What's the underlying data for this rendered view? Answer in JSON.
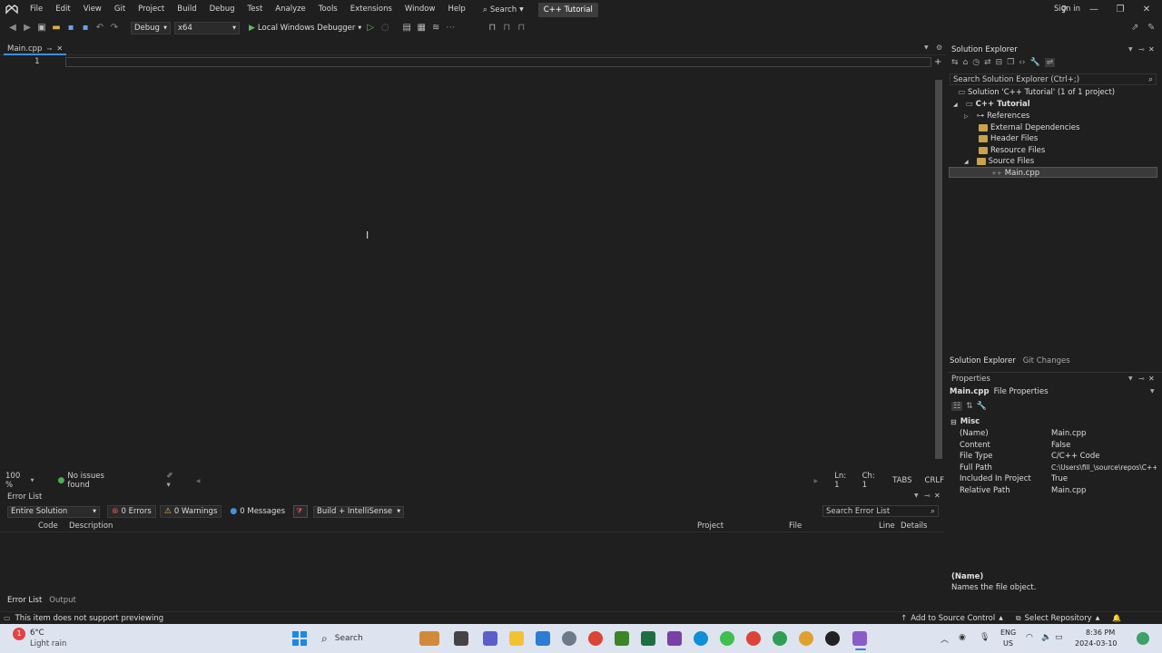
{
  "menu": {
    "items": [
      "File",
      "Edit",
      "View",
      "Git",
      "Project",
      "Build",
      "Debug",
      "Test",
      "Analyze",
      "Tools",
      "Extensions",
      "Window",
      "Help"
    ],
    "search_label": "Search",
    "solution_badge": "C++ Tutorial",
    "sign_in": "Sign in"
  },
  "toolbar": {
    "config": "Debug",
    "platform": "x64",
    "run_label": "Local Windows Debugger"
  },
  "editor": {
    "tab_label": "Main.cpp",
    "line_number": "1",
    "zoom": "100 %",
    "issues": "No issues found",
    "ln": "Ln: 1",
    "ch": "Ch: 1",
    "tabs": "TABS",
    "eol": "CRLF"
  },
  "error_list": {
    "title": "Error List",
    "scope": "Entire Solution",
    "errors": "0 Errors",
    "warnings": "0 Warnings",
    "messages": "0 Messages",
    "build_filter": "Build + IntelliSense",
    "search_placeholder": "Search Error List",
    "columns": {
      "code": "Code",
      "description": "Description",
      "project": "Project",
      "file": "File",
      "line": "Line",
      "details": "Details"
    },
    "bottom_tabs": [
      "Error List",
      "Output"
    ]
  },
  "solution_explorer": {
    "title": "Solution Explorer",
    "search_placeholder": "Search Solution Explorer (Ctrl+;)",
    "tree": {
      "solution": "Solution 'C++ Tutorial' (1 of 1 project)",
      "project": "C++ Tutorial",
      "references": "References",
      "external": "External Dependencies",
      "header": "Header Files",
      "resource": "Resource Files",
      "source": "Source Files",
      "file": "Main.cpp"
    },
    "tabs": [
      "Solution Explorer",
      "Git Changes"
    ]
  },
  "properties": {
    "title": "Properties",
    "object_name": "Main.cpp",
    "object_type": "File Properties",
    "category": "Misc",
    "rows": [
      {
        "key": "(Name)",
        "value": "Main.cpp"
      },
      {
        "key": "Content",
        "value": "False"
      },
      {
        "key": "File Type",
        "value": "C/C++ Code"
      },
      {
        "key": "Full Path",
        "value": "C:\\Users\\fill_\\source\\repos\\C++"
      },
      {
        "key": "Included In Project",
        "value": "True"
      },
      {
        "key": "Relative Path",
        "value": "Main.cpp"
      }
    ],
    "desc_title": "(Name)",
    "desc_text": "Names the file object."
  },
  "statusbar": {
    "left": "This item does not support previewing",
    "source_control": "Add to Source Control",
    "repository": "Select Repository"
  },
  "taskbar": {
    "weather_temp": "6°C",
    "weather_desc": "Light rain",
    "search_label": "Search",
    "lang": "ENG",
    "region": "US",
    "time": "8:36 PM",
    "date": "2024-03-10"
  },
  "colors": {
    "accent": "#3b8eea",
    "background": "#1f1f1f",
    "taskbar": "#dde4ef",
    "badge": "#3d3d3d"
  }
}
